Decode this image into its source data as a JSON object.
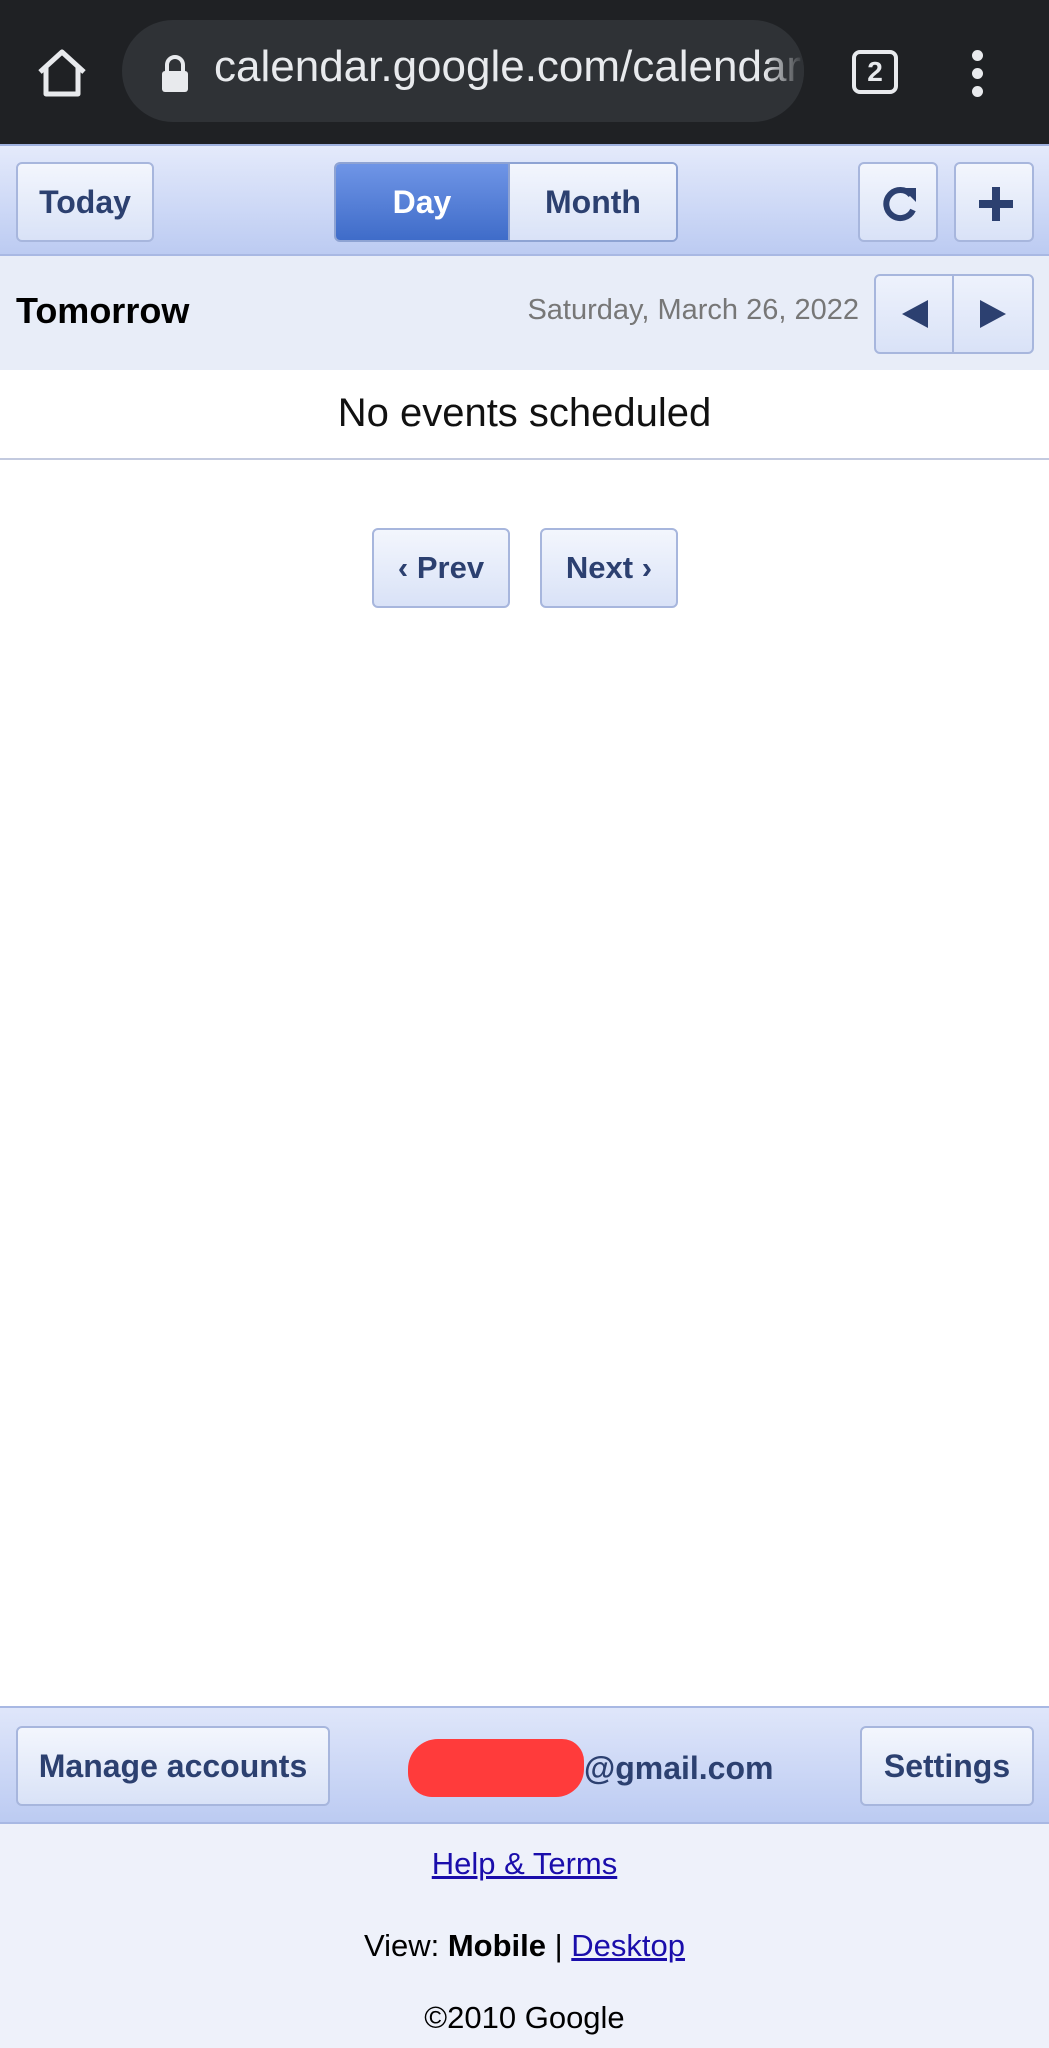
{
  "browser": {
    "url": "calendar.google.com/calendar",
    "tab_count": "2"
  },
  "toolbar": {
    "today_label": "Today",
    "day_label": "Day",
    "month_label": "Month"
  },
  "date_header": {
    "title": "Tomorrow",
    "date": "Saturday, March 26, 2022"
  },
  "events": {
    "empty_message": "No events scheduled"
  },
  "pager": {
    "prev_label": "‹ Prev",
    "next_label": "Next ›"
  },
  "account_bar": {
    "manage_label": "Manage accounts",
    "email_suffix": "@gmail.com",
    "settings_label": "Settings"
  },
  "footer": {
    "help_label": "Help & Terms",
    "view_prefix": "View: ",
    "view_mobile": "Mobile",
    "view_separator": " | ",
    "view_desktop": "Desktop",
    "copyright": "©2010 Google"
  },
  "colors": {
    "accent": "#4a76d4",
    "redaction": "#ff3b3b",
    "link": "#1a0dab"
  }
}
